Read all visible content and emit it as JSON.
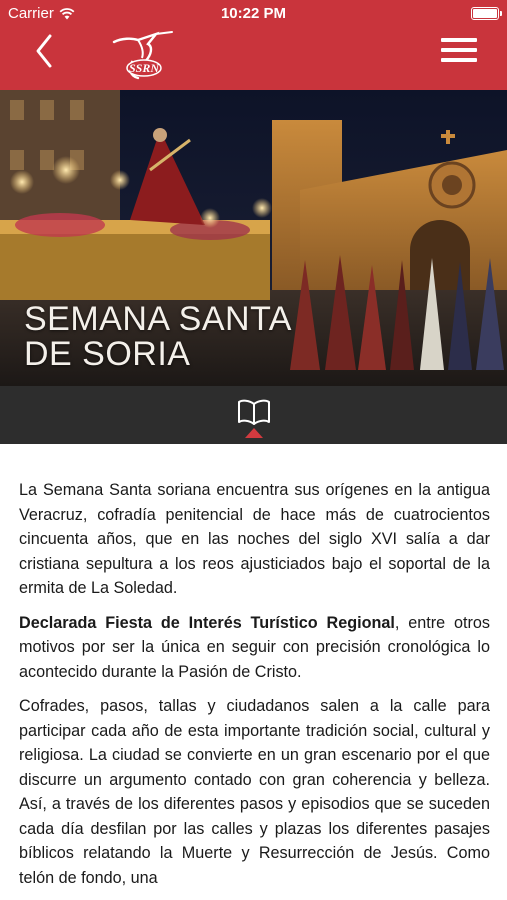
{
  "status_bar": {
    "carrier": "Carrier",
    "time": "10:22 PM",
    "battery_level": 1.0
  },
  "nav": {
    "back_icon": "chevron-left-icon",
    "logo": "hooded-penitent-logo",
    "logo_text": "SSRN",
    "menu_icon": "hamburger-menu-icon",
    "background_color": "#c9343c"
  },
  "hero": {
    "title_line1": "SEMANA SANTA",
    "title_line2": "DE SORIA"
  },
  "tabs": {
    "active_icon": "book-icon",
    "indicator_color": "#d23a3f",
    "background_color": "#2d2d2d"
  },
  "article": {
    "paragraph1": "La Semana Santa soriana encuentra sus orígenes en la antigua Veracruz, cofradía penitencial de hace más de cuatrocientos cincuenta años, que en las noches del siglo XVI salía a dar cristiana sepultura a los reos ajusticiados bajo el soportal de la ermita de La Soledad.",
    "paragraph2_bold": "Declarada Fiesta de Interés Turístico Regional",
    "paragraph2_rest": ", entre otros motivos por ser la única en seguir con precisión cronológica lo acontecido durante la Pasión de Cristo.",
    "paragraph3": "Cofrades, pasos, tallas y ciudadanos salen a la calle para participar cada año de esta importante tradición social, cultural y religiosa. La ciudad se convierte en un gran escenario por el que discurre un argumento contado con gran coherencia y belleza. Así, a través de los diferentes pasos y episodios que se suceden cada día desfilan por las calles y plazas los diferentes pasajes bíblicos relatando la Muerte y Resurrección de Jesús. Como telón de fondo, una"
  }
}
